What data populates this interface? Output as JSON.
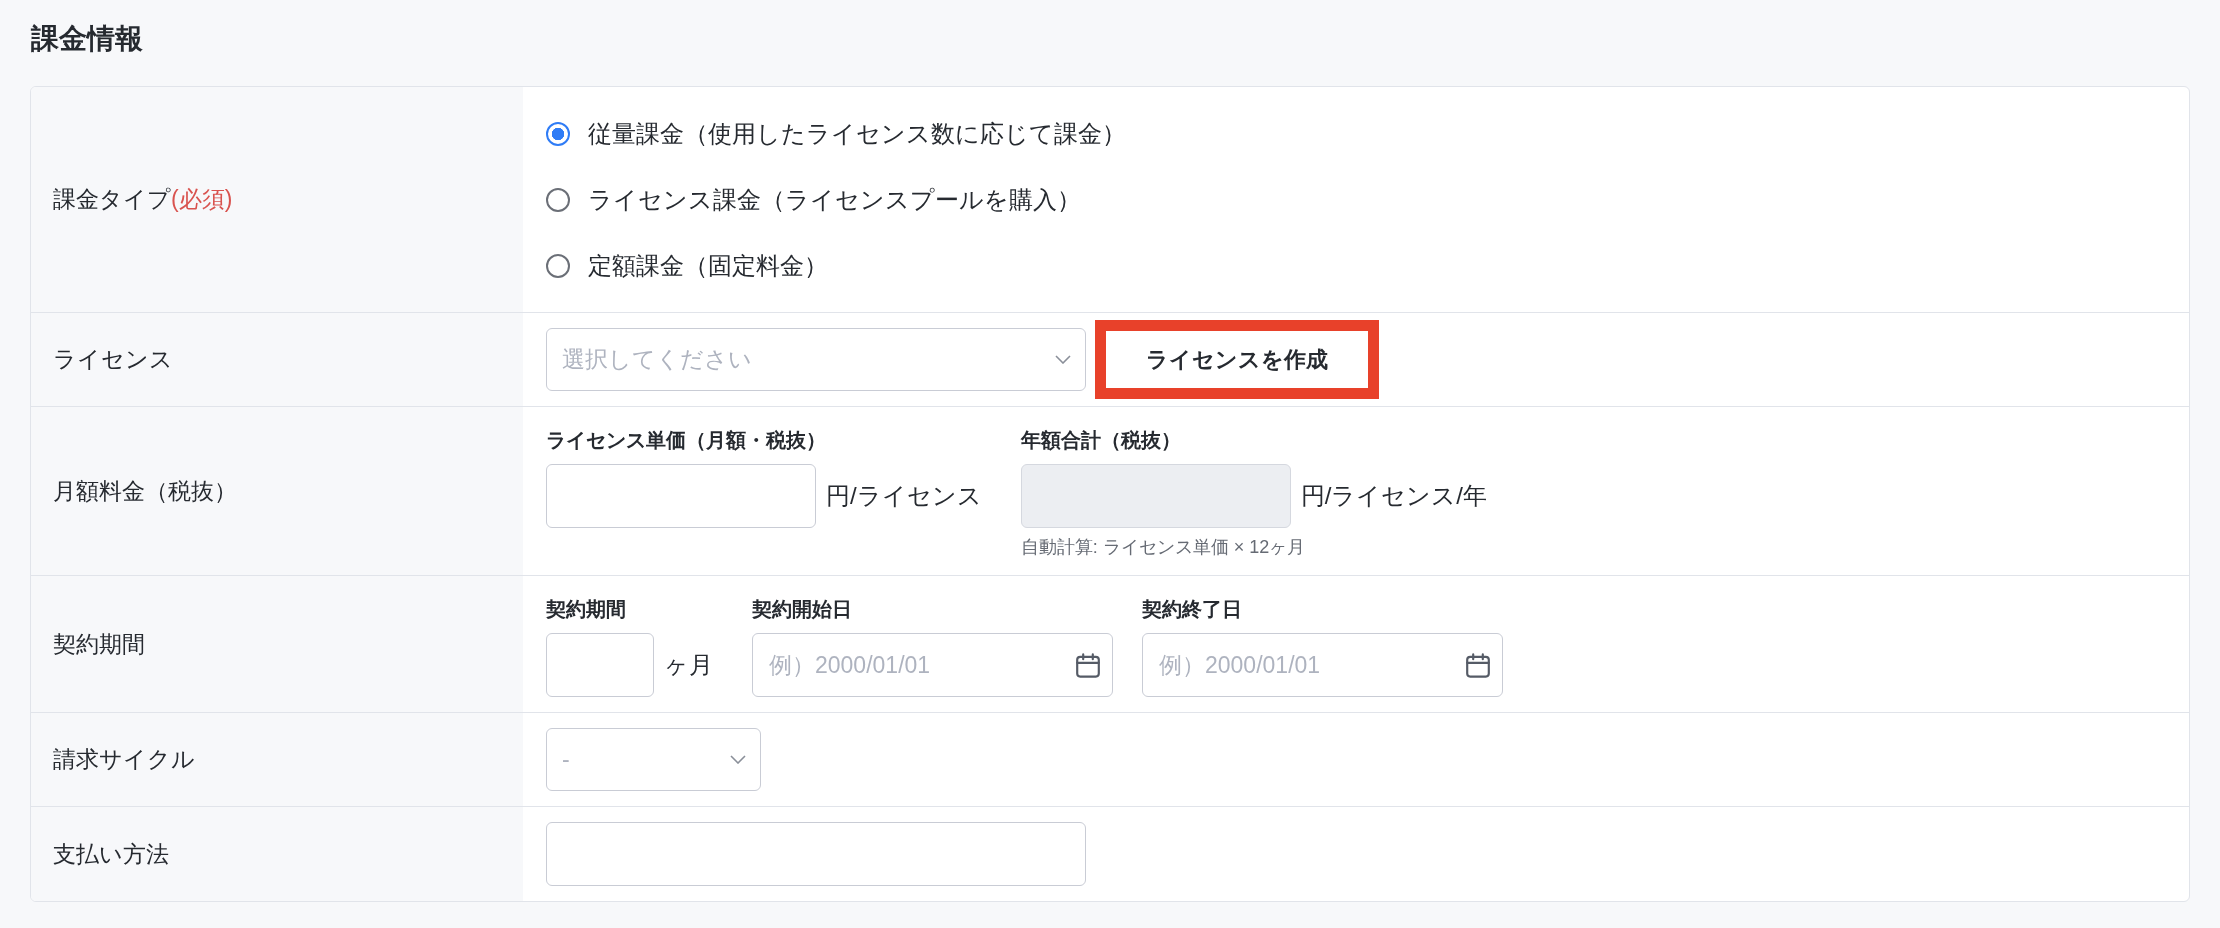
{
  "section": {
    "title": "課金情報"
  },
  "form_rows": [
    {
      "kind": "radio_group",
      "label": "課金タイプ",
      "required_mark": "(必須)",
      "options": [
        {
          "label": "従量課金（使用したライセンス数に応じて課金）",
          "selected": true
        },
        {
          "label": "ライセンス課金（ライセンスプールを購入）",
          "selected": false
        },
        {
          "label": "定額課金（固定料金）",
          "selected": false
        }
      ]
    },
    {
      "kind": "select_with_button",
      "label": "ライセンス",
      "select": {
        "placeholder": "選択してください"
      },
      "button": {
        "label": "ライセンスを作成",
        "highlighted": true
      }
    },
    {
      "kind": "field_group",
      "label": "月額料金（税抜）",
      "fields": [
        {
          "kind": "amount",
          "label": "ライセンス単価（月額・税抜）",
          "unit": "円/ライセンス",
          "disabled": false
        },
        {
          "kind": "amount",
          "label": "年額合計（税抜）",
          "unit": "円/ライセンス/年",
          "disabled": true,
          "hint": "自動計算: ライセンス単価 × 12ヶ月"
        }
      ]
    },
    {
      "kind": "field_group",
      "label": "契約期間",
      "fields": [
        {
          "kind": "months",
          "label": "契約期間",
          "unit": "ヶ月",
          "disabled": false
        },
        {
          "kind": "date",
          "label": "契約開始日",
          "placeholder": "例）2000/01/01",
          "disabled": false
        },
        {
          "kind": "date",
          "label": "契約終了日",
          "placeholder": "例）2000/01/01",
          "disabled": false
        }
      ]
    },
    {
      "kind": "select",
      "label": "請求サイクル",
      "select": {
        "placeholder": "-"
      }
    },
    {
      "kind": "input",
      "label": "支払い方法"
    }
  ]
}
